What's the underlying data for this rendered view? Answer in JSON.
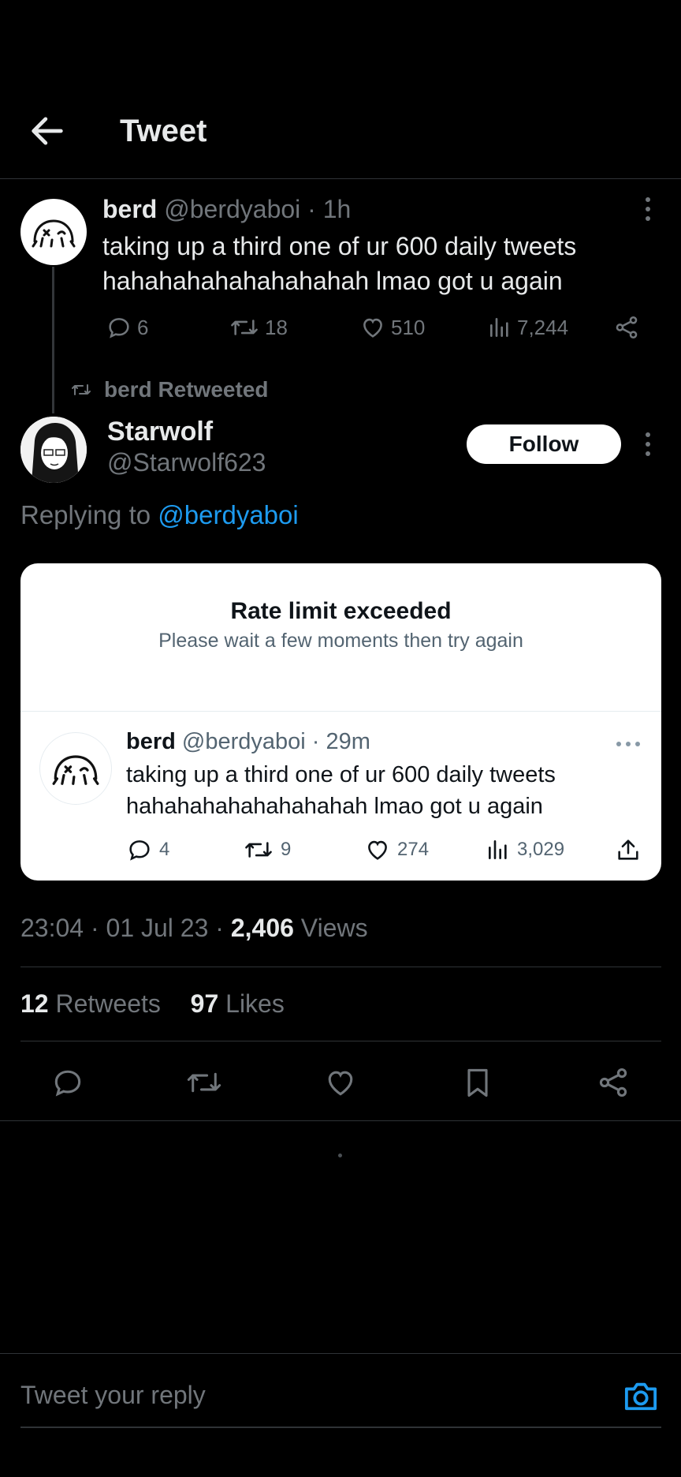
{
  "header": {
    "title": "Tweet"
  },
  "top_tweet": {
    "name": "berd",
    "handle": "@berdyaboi",
    "time": "· 1h",
    "text": "taking up a third one of ur 600 daily tweets hahahahahahahahahah lmao got u again",
    "replies": "6",
    "retweets": "18",
    "likes": "510",
    "views": "7,244"
  },
  "retweet_banner": "berd Retweeted",
  "main_tweet": {
    "name": "Starwolf",
    "handle": "@Starwolf623",
    "follow_label": "Follow",
    "replying_prefix": "Replying to ",
    "replying_handle": "@berdyaboi"
  },
  "card": {
    "title": "Rate limit exceeded",
    "subtitle": "Please wait a few moments then try again",
    "quoted": {
      "name": "berd",
      "handle": "@berdyaboi",
      "time": "· 29m",
      "text": "taking up a third one of ur 600 daily tweets hahahahahahahahahah lmao got u again",
      "replies": "4",
      "retweets": "9",
      "likes": "274",
      "views": "3,029"
    }
  },
  "meta": {
    "time": "23:04 · 01 Jul 23 · ",
    "views_count": "2,406",
    "views_label": " Views"
  },
  "stats": {
    "retweets_count": "12",
    "retweets_label": " Retweets",
    "likes_count": "97",
    "likes_label": " Likes"
  },
  "reply": {
    "placeholder": "Tweet your reply"
  },
  "colors": {
    "accent": "#1d9bf0",
    "background": "#000000",
    "muted": "#71767b"
  },
  "icons": [
    "back-arrow-icon",
    "reply-icon",
    "retweet-icon",
    "like-icon",
    "views-icon",
    "share-icon",
    "bookmark-icon",
    "more-icon",
    "camera-icon",
    "upload-icon"
  ]
}
